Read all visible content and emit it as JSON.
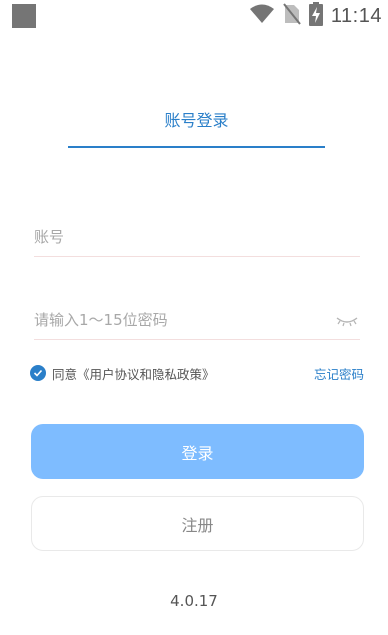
{
  "status_bar": {
    "time": "11:14",
    "icons": [
      "app-notification-icon",
      "wifi-icon",
      "no-sim-icon",
      "battery-charging-icon"
    ]
  },
  "tabs": [
    {
      "label": "账号登录",
      "active": true
    }
  ],
  "form": {
    "account_placeholder": "账号",
    "password_placeholder": "请输入1～15位密码"
  },
  "agreement": {
    "checked": true,
    "text": "同意《用户协议和隐私政策》",
    "forgot_label": "忘记密码"
  },
  "buttons": {
    "login_label": "登录",
    "register_label": "注册"
  },
  "version": "4.0.17",
  "colors": {
    "accent": "#2a7fc9",
    "login_button": "#7ebcff"
  }
}
